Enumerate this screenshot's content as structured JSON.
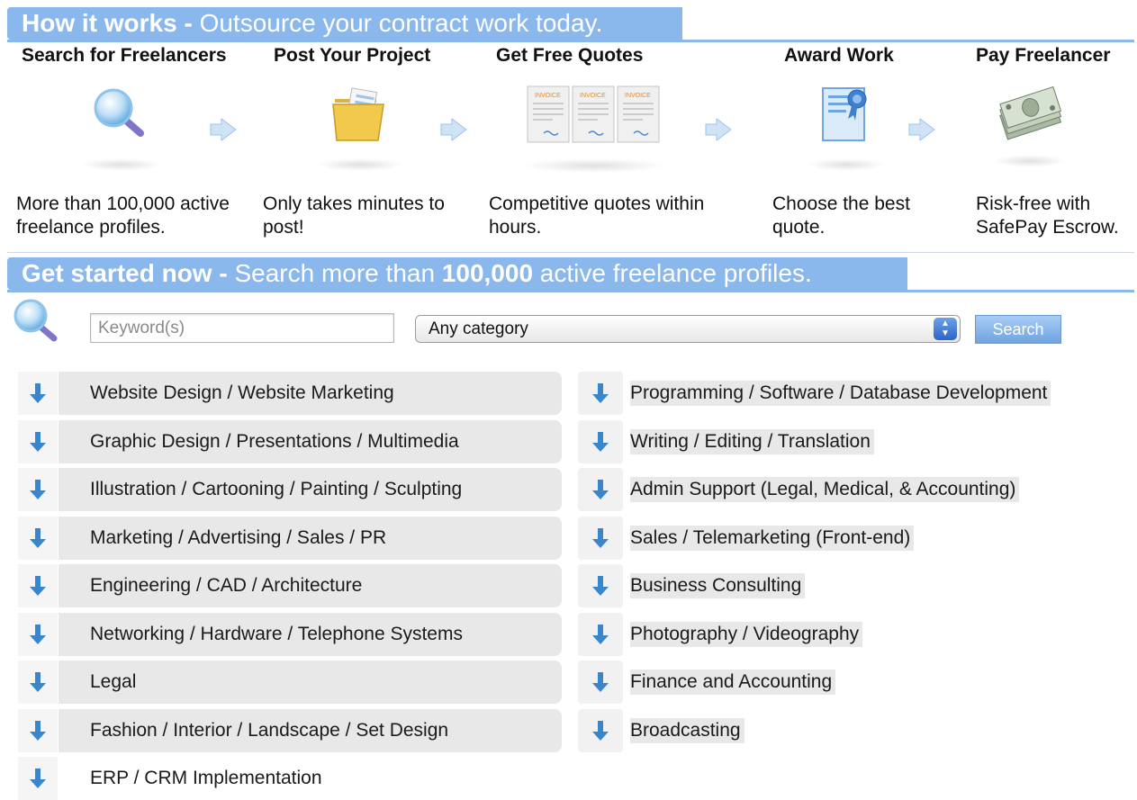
{
  "how_it_works": {
    "title_bold": "How it works - ",
    "title_rest": "Outsource your contract work today."
  },
  "steps": [
    {
      "title": "Search for Freelancers",
      "desc": "More than 100,000 active freelance profiles.",
      "icon": "magnifier-icon"
    },
    {
      "title": "Post Your Project",
      "desc": "Only takes minutes to post!",
      "icon": "folder-icon"
    },
    {
      "title": "Get Free Quotes",
      "desc": "Competitive quotes within hours.",
      "icon": "quotes-documents-icon"
    },
    {
      "title": "Award Work",
      "desc": "Choose the best quote.",
      "icon": "certificate-icon"
    },
    {
      "title": "Pay Freelancer",
      "desc": "Risk-free with SafePay Escrow.",
      "icon": "money-icon"
    }
  ],
  "get_started": {
    "bold1": "Get started now - ",
    "rest1": "Search more than ",
    "bold2": "100,000",
    "rest2": " active freelance profiles."
  },
  "search": {
    "keyword_placeholder": "Keyword(s)",
    "category_selected": "Any category",
    "button_label": "Search"
  },
  "categories_left": [
    "Website Design / Website Marketing",
    "Graphic Design / Presentations / Multimedia",
    "Illustration / Cartooning / Painting / Sculpting",
    "Marketing / Advertising / Sales / PR",
    "Engineering / CAD / Architecture",
    "Networking / Hardware / Telephone Systems",
    "Legal",
    "Fashion / Interior / Landscape / Set Design",
    "ERP / CRM Implementation"
  ],
  "categories_right": [
    "Programming / Software / Database Development",
    "Writing / Editing / Translation",
    "Admin Support (Legal, Medical, & Accounting)",
    "Sales / Telemarketing (Front-end)",
    "Business Consulting",
    "Photography / Videography",
    "Finance and Accounting",
    "Broadcasting"
  ],
  "colors": {
    "banner": "#8ab7ec",
    "arrow": "#3a86cc",
    "row_bg": "#e8e8e8"
  }
}
